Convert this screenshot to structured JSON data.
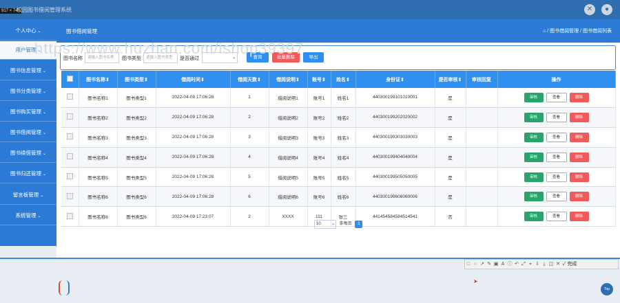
{
  "window": {
    "size_label": "917 × 747",
    "app_title": "校园图书借阅管理系统"
  },
  "sidebar": {
    "items": [
      {
        "label": "个人中心",
        "arrow": "⌄"
      },
      {
        "label": "用户管理",
        "arrow": "⌄"
      },
      {
        "label": "图书信息管理",
        "arrow": "⌄"
      },
      {
        "label": "图书分类管理",
        "arrow": "⌄"
      },
      {
        "label": "图书购买管理",
        "arrow": "⌄"
      },
      {
        "label": "图书借阅管理",
        "arrow": "⌄"
      },
      {
        "label": "图书续借管理",
        "arrow": "⌄"
      },
      {
        "label": "图书归还管理",
        "arrow": "⌄"
      },
      {
        "label": "留言板管理",
        "arrow": "⌄"
      },
      {
        "label": "系统管理",
        "arrow": "⌄"
      }
    ]
  },
  "page": {
    "heading": "图书借阅管理",
    "breadcrumb": "⌂ / 图书借阅管理 / 图书借阅列表",
    "watermark": "https://www.huzhan.com/ishop39397"
  },
  "search": {
    "book_name_label": "图书名称",
    "book_name_placeholder": "请输入图书名称",
    "book_type_label": "图书类型",
    "book_type_placeholder": "请输入图书类型",
    "approved_label": "是否通过",
    "approved_value": "",
    "query_button": "查询",
    "batch_delete_button": "批量删除",
    "export_button": "导出"
  },
  "table": {
    "columns": [
      "",
      "图书名称⇕",
      "图书类型⇕",
      "借阅时间⇕",
      "借阅天数⇕",
      "借阅说明⇕",
      "账号⇕",
      "姓名⇕",
      "身份证⇕",
      "是否审核⇕",
      "审核回复",
      "操作"
    ],
    "actions": {
      "review": "审核",
      "view": "查看",
      "delete": "删除"
    },
    "rows": [
      {
        "name": "图书名称1",
        "type": "图书类型1",
        "time": "2022-04-09 17:06:28",
        "days": "1",
        "note": "借阅说明1",
        "account": "账号1",
        "person": "姓名1",
        "idcard": "440300199101010001",
        "audited": "是",
        "reply": ""
      },
      {
        "name": "图书名称2",
        "type": "图书类型2",
        "time": "2022-04-09 17:06:28",
        "days": "2",
        "note": "借阅说明2",
        "account": "账号2",
        "person": "姓名2",
        "idcard": "440300199202020002",
        "audited": "是",
        "reply": ""
      },
      {
        "name": "图书名称3",
        "type": "图书类型3",
        "time": "2022-04-09 17:06:28",
        "days": "3",
        "note": "借阅说明3",
        "account": "账号3",
        "person": "姓名3",
        "idcard": "440300199303030003",
        "audited": "是",
        "reply": ""
      },
      {
        "name": "图书名称4",
        "type": "图书类型4",
        "time": "2022-04-09 17:06:28",
        "days": "4",
        "note": "借阅说明4",
        "account": "账号4",
        "person": "姓名4",
        "idcard": "440300199404040004",
        "audited": "是",
        "reply": ""
      },
      {
        "name": "图书名称5",
        "type": "图书类型5",
        "time": "2022-04-09 17:06:28",
        "days": "5",
        "note": "借阅说明5",
        "account": "账号5",
        "person": "姓名5",
        "idcard": "440300199505050005",
        "audited": "是",
        "reply": ""
      },
      {
        "name": "图书名称6",
        "type": "图书类型6",
        "time": "2022-04-09 17:06:28",
        "days": "6",
        "note": "借阅说明6",
        "account": "账号6",
        "person": "姓名6",
        "idcard": "440300199606060006",
        "audited": "是",
        "reply": ""
      },
      {
        "name": "图书名称6",
        "type": "图书类型6",
        "time": "2022-04-09 17:23:07",
        "days": "2",
        "note": "XXXX",
        "account": "111",
        "person": "张三",
        "idcard": "441454584584514541",
        "audited": "否",
        "reply": ""
      }
    ]
  },
  "pager": {
    "page_size": "10",
    "per_page_label": "条每页",
    "current_page": "1"
  },
  "toolbar": {
    "icons": [
      "□",
      "○",
      "↗",
      "✎",
      "▣",
      "A",
      "ⓘ",
      "↶",
      "⤢",
      "⌖",
      "⇩",
      "⤓",
      "◫",
      "✕"
    ],
    "done_label": "✓ 完成"
  },
  "top_button": "Top"
}
